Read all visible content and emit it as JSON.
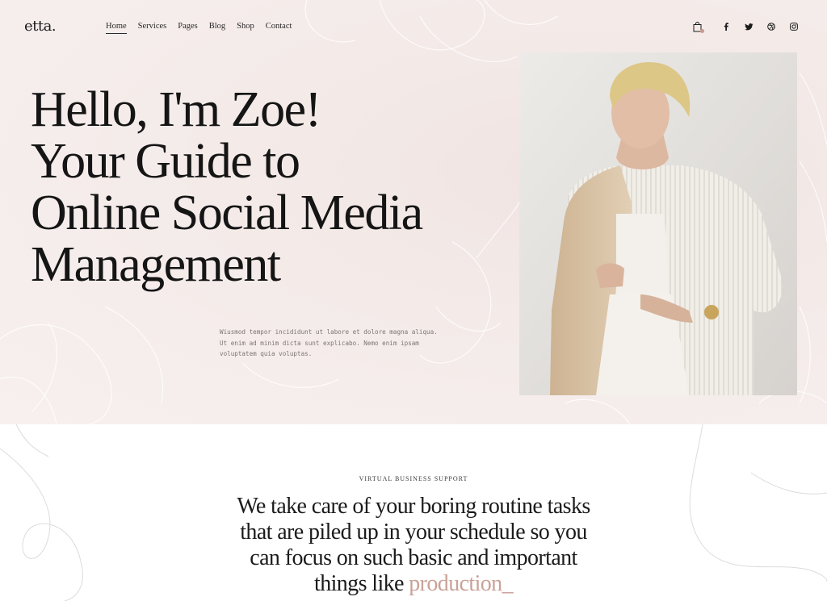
{
  "header": {
    "logo": "etta.",
    "nav": [
      {
        "label": "Home",
        "active": true
      },
      {
        "label": "Services"
      },
      {
        "label": "Pages"
      },
      {
        "label": "Blog"
      },
      {
        "label": "Shop"
      },
      {
        "label": "Contact"
      }
    ],
    "icons": [
      "shopping-bag-icon",
      "facebook-icon",
      "twitter-icon",
      "dribbble-icon",
      "instagram-icon"
    ]
  },
  "hero": {
    "headline_lines": [
      "Hello, I'm Zoe!",
      "Your Guide to",
      "Online Social Media",
      "Management"
    ],
    "intro": "Wiusmod tempor incididunt ut labore et dolore magna aliqua. Ut enim ad minim dicta sunt explicabo. Nemo enim ipsam voluptatem quia voluptas."
  },
  "section2": {
    "eyebrow": "VIRTUAL BUSINESS SUPPORT",
    "tagline_lines": [
      "We take care of your boring routine tasks",
      "that are piled up in your schedule so you",
      "can focus on such basic and important",
      "things like"
    ],
    "tagline_accent": "production",
    "tagline_cursor": "_"
  },
  "colors": {
    "hero_bg": "#f4ebe9",
    "accent": "#c9a197",
    "text": "#1b1b1b"
  }
}
